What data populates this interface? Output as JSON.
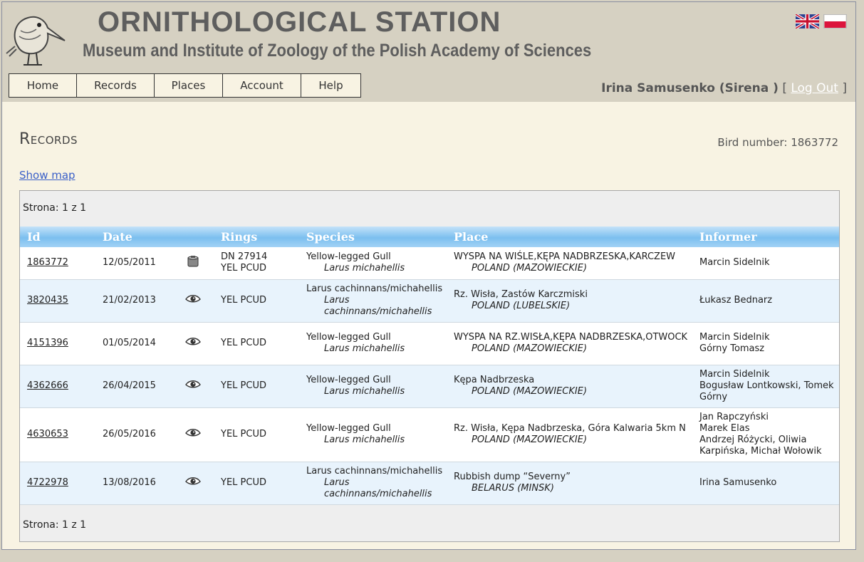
{
  "header": {
    "title": "ORNITHOLOGICAL STATION",
    "subtitle": "Museum and Institute of Zoology of the Polish Academy of Sciences",
    "flags": [
      "uk-flag",
      "poland-flag"
    ]
  },
  "nav": [
    {
      "label": "Home"
    },
    {
      "label": "Records"
    },
    {
      "label": "Places"
    },
    {
      "label": "Account"
    },
    {
      "label": "Help"
    }
  ],
  "user": {
    "name": "Irina Samusenko (Sirena )",
    "open_bracket": "[",
    "logout_label": "Log Out",
    "close_bracket": "]"
  },
  "page": {
    "title": "Records",
    "bird_number_label": "Bird number:",
    "bird_number": "1863772",
    "show_map_label": "Show map",
    "pager_text": "Strona: 1 z 1"
  },
  "table": {
    "columns": [
      "Id",
      "Date",
      "",
      "Rings",
      "Species",
      "Place",
      "Informer"
    ],
    "rows": [
      {
        "id": "1863772",
        "date": "12/05/2011",
        "icon": "ring-icon",
        "rings": [
          "DN 27914",
          "YEL PCUD"
        ],
        "species": "Yellow-legged Gull",
        "species_sci": "Larus michahellis",
        "place": "WYSPA NA WIŚLE,KĘPA NADBRZESKA,KARCZEW",
        "place_country": "POLAND (MAZOWIECKIE)",
        "informer": [
          "Marcin Sidelnik"
        ]
      },
      {
        "id": "3820435",
        "date": "21/02/2013",
        "icon": "eye-icon",
        "rings": [
          "YEL PCUD"
        ],
        "species": "Larus cachinnans/michahellis",
        "species_sci": "Larus cachinnans/michahellis",
        "place": "Rz. Wisła, Zastów Karczmiski",
        "place_country": "POLAND (LUBELSKIE)",
        "informer": [
          "Łukasz Bednarz"
        ]
      },
      {
        "id": "4151396",
        "date": "01/05/2014",
        "icon": "eye-icon",
        "rings": [
          "YEL PCUD"
        ],
        "species": "Yellow-legged Gull",
        "species_sci": "Larus michahellis",
        "place": "WYSPA NA RZ.WISŁA,KĘPA NADBRZESKA,OTWOCK",
        "place_country": "POLAND (MAZOWIECKIE)",
        "informer": [
          "Marcin Sidelnik",
          "Górny Tomasz"
        ]
      },
      {
        "id": "4362666",
        "date": "26/04/2015",
        "icon": "eye-icon",
        "rings": [
          "YEL PCUD"
        ],
        "species": "Yellow-legged Gull",
        "species_sci": "Larus michahellis",
        "place": "Kępa Nadbrzeska",
        "place_country": "POLAND (MAZOWIECKIE)",
        "informer": [
          "Marcin Sidelnik",
          "Bogusław Lontkowski, Tomek Górny"
        ]
      },
      {
        "id": "4630653",
        "date": "26/05/2016",
        "icon": "eye-icon",
        "rings": [
          "YEL PCUD"
        ],
        "species": "Yellow-legged Gull",
        "species_sci": "Larus michahellis",
        "place": "Rz. Wisła, Kępa Nadbrzeska, Góra Kalwaria 5km N",
        "place_country": "POLAND (MAZOWIECKIE)",
        "informer": [
          "Jan Rapczyński",
          "Marek Elas",
          "Andrzej Różycki, Oliwia Karpińska, Michał Wołowik"
        ]
      },
      {
        "id": "4722978",
        "date": "13/08/2016",
        "icon": "eye-icon",
        "rings": [
          "YEL PCUD"
        ],
        "species": "Larus cachinnans/michahellis",
        "species_sci": "Larus cachinnans/michahellis",
        "place": "Rubbish dump “Severny”",
        "place_country": "BELARUS (MINSK)",
        "informer": [
          "Irina Samusenko"
        ]
      }
    ]
  }
}
